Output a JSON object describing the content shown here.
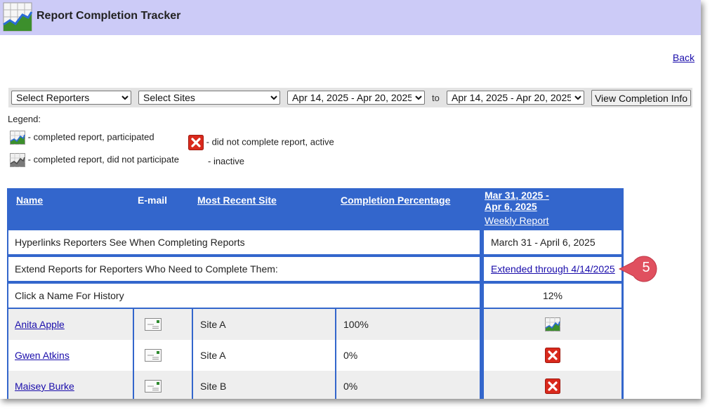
{
  "app": {
    "title": "Report Completion Tracker",
    "back_label": "Back"
  },
  "filters": {
    "reporters_selected": "Select Reporters",
    "sites_selected": "Select Sites",
    "from_week": "Apr 14, 2025 - Apr 20, 2025",
    "to_label": "to",
    "to_week": "Apr 14, 2025 - Apr 20, 2025",
    "view_button": "View Completion Info"
  },
  "legend": {
    "title": "Legend:",
    "completed_participated": "- completed report, participated",
    "completed_not_participated": "- completed report, did not participate",
    "not_completed_active": "- did not complete report, active",
    "inactive": "- inactive"
  },
  "table": {
    "headers": {
      "name": "Name",
      "email": "E-mail",
      "site": "Most Recent Site",
      "completion": "Completion Percentage",
      "week_line1": "Mar 31, 2025 -",
      "week_line2": "Apr 6, 2025",
      "weekly_report": "Weekly Report"
    },
    "info_rows": [
      {
        "label": "Hyperlinks Reporters See When Completing Reports",
        "value": "March 31 - April 6, 2025"
      },
      {
        "label": "Extend Reports for Reporters Who Need to Complete Them:",
        "value": "Extended through 4/14/2025"
      },
      {
        "label": "Click a Name For History",
        "value": "12%"
      }
    ],
    "rows": [
      {
        "name": "Anita Apple",
        "site": "Site A",
        "completion": "100%",
        "status": "completed-participated"
      },
      {
        "name": "Gwen Atkins",
        "site": "Site A",
        "completion": "0%",
        "status": "not-completed-active"
      },
      {
        "name": "Maisey Burke",
        "site": "Site B",
        "completion": "0%",
        "status": "not-completed-active"
      }
    ]
  },
  "callout": {
    "number": "5",
    "color": "#e0505f"
  },
  "colors": {
    "header_bg": "#3366cc",
    "titlebar_bg": "#cccbf7",
    "link": "#1a0dab",
    "error_red": "#d9291c"
  },
  "icons": [
    "chart-icon",
    "grey-chart-icon",
    "red-x-icon",
    "mail-icon"
  ]
}
